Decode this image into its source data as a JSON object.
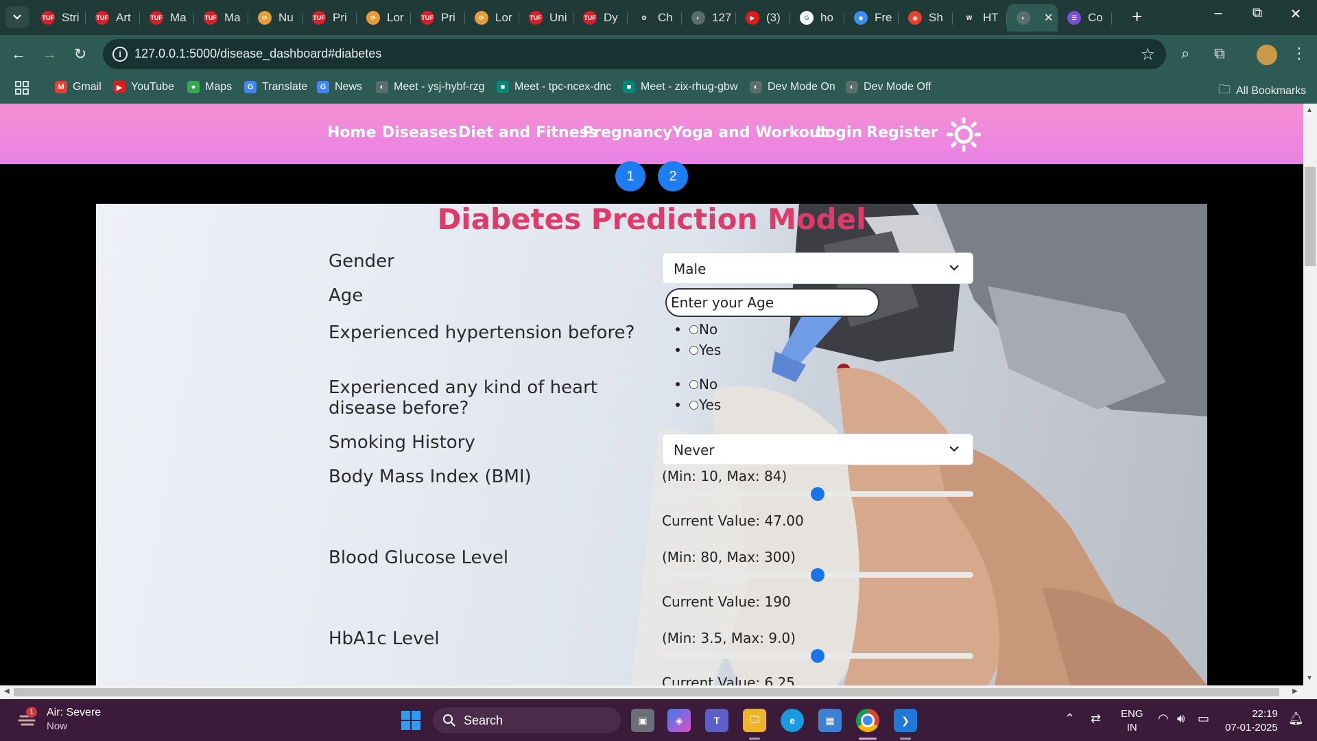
{
  "browser": {
    "tabs": [
      {
        "label": "Stri",
        "favicon": "TUF",
        "color": "#d81f2a"
      },
      {
        "label": "Art",
        "favicon": "TUF",
        "color": "#d81f2a"
      },
      {
        "label": "Ma",
        "favicon": "TUF",
        "color": "#d81f2a"
      },
      {
        "label": "Ma",
        "favicon": "TUF",
        "color": "#d81f2a"
      },
      {
        "label": "Nu",
        "favicon": "⟳",
        "color": "#e89b3a"
      },
      {
        "label": "Pri",
        "favicon": "TUF",
        "color": "#d81f2a"
      },
      {
        "label": "Lor",
        "favicon": "⟳",
        "color": "#e89b3a"
      },
      {
        "label": "Pri",
        "favicon": "TUF",
        "color": "#d81f2a"
      },
      {
        "label": "Lor",
        "favicon": "⟳",
        "color": "#e89b3a"
      },
      {
        "label": "Uni",
        "favicon": "TUF",
        "color": "#d81f2a"
      },
      {
        "label": "Dy",
        "favicon": "TUF",
        "color": "#d81f2a"
      },
      {
        "label": "Ch",
        "favicon": "✿",
        "color": "#1f3a37"
      },
      {
        "label": "127",
        "favicon": "◐",
        "color": "#5a6e6b"
      },
      {
        "label": "(3)",
        "favicon": "▶",
        "color": "#e01c1c"
      },
      {
        "label": "ho",
        "favicon": "G",
        "color": "#ffffff"
      },
      {
        "label": "Fre",
        "favicon": "◆",
        "color": "#3a8ef0"
      },
      {
        "label": "Sh",
        "favicon": "◉",
        "color": "#e8402f"
      },
      {
        "label": "HT",
        "favicon": "W",
        "color": "#1f3a37"
      },
      {
        "label": "",
        "favicon": "◐",
        "color": "#5a6e6b",
        "active": true
      },
      {
        "label": "Co",
        "favicon": "☰",
        "color": "#7a4fd8"
      }
    ],
    "url": "127.0.0.1:5000/disease_dashboard#diabetes",
    "bookmarks": [
      {
        "label": "Gmail",
        "icon": "M",
        "color": "#e44133"
      },
      {
        "label": "YouTube",
        "icon": "▶",
        "color": "#e01c1c"
      },
      {
        "label": "Maps",
        "icon": "●",
        "color": "#34a853"
      },
      {
        "label": "Translate",
        "icon": "G",
        "color": "#4285f4"
      },
      {
        "label": "News",
        "icon": "G",
        "color": "#4285f4"
      },
      {
        "label": "Meet - ysj-hybf-rzg",
        "icon": "◐",
        "color": "#5a6e6b"
      },
      {
        "label": "Meet - tpc-ncex-dnc",
        "icon": "■",
        "color": "#00897b"
      },
      {
        "label": "Meet - zix-rhug-gbw",
        "icon": "■",
        "color": "#00897b"
      },
      {
        "label": "Dev Mode On",
        "icon": "◐",
        "color": "#5a6e6b"
      },
      {
        "label": "Dev Mode Off",
        "icon": "◐",
        "color": "#5a6e6b"
      }
    ],
    "all_bookmarks": "All Bookmarks"
  },
  "site": {
    "nav": [
      "Home",
      "Diseases",
      "Diet and Fitness",
      "Pregnancy",
      "Yoga and Workout",
      "Login",
      "Register"
    ],
    "pages": [
      "1",
      "2"
    ],
    "title": "Diabetes Prediction Model",
    "form": {
      "gender_label": "Gender",
      "gender_value": "Male",
      "age_label": "Age",
      "age_placeholder": "Enter your Age",
      "hypertension_label": "Experienced hypertension before?",
      "heart_label": "Experienced any kind of heart disease before?",
      "option_no": "No",
      "option_yes": "Yes",
      "smoking_label": "Smoking History",
      "smoking_value": "Never",
      "bmi_label": "Body Mass Index (BMI)",
      "bmi_range": "(Min: 10, Max: 84)",
      "bmi_current": "Current Value: 47.00",
      "bmi_fraction": 0.5,
      "glucose_label": "Blood Glucose Level",
      "glucose_range": "(Min: 80, Max: 300)",
      "glucose_current": "Current Value: 190",
      "glucose_fraction": 0.5,
      "hba1c_label": "HbA1c Level",
      "hba1c_range": "(Min: 3.5, Max: 9.0)",
      "hba1c_current": "Current Value: 6.25",
      "hba1c_fraction": 0.5
    }
  },
  "taskbar": {
    "weather_title": "Air: Severe",
    "weather_sub": "Now",
    "weather_badge": "1",
    "search": "Search",
    "lang1": "ENG",
    "lang2": "IN",
    "time": "22:19",
    "date": "07-01-2025"
  }
}
